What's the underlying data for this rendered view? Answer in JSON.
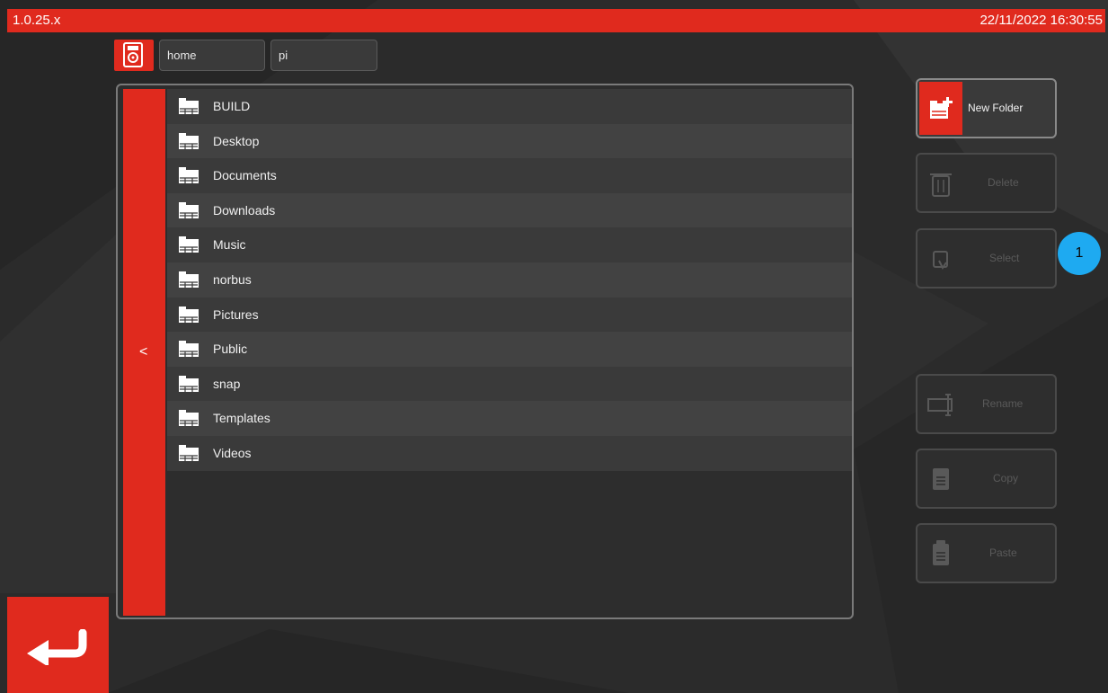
{
  "header": {
    "version": "1.0.25.x",
    "datetime": "22/11/2022 16:30:55"
  },
  "breadcrumb": {
    "root_icon": "drive-icon",
    "items": [
      "home",
      "pi"
    ]
  },
  "file_list": {
    "back_label": "<",
    "folders": [
      "BUILD",
      "Desktop",
      "Documents",
      "Downloads",
      "Music",
      "norbus",
      "Pictures",
      "Public",
      "snap",
      "Templates",
      "Videos"
    ]
  },
  "actions": {
    "new_folder": "New Folder",
    "delete": "Delete",
    "select": "Select",
    "rename": "Rename",
    "copy": "Copy",
    "paste": "Paste"
  },
  "callout": {
    "label": "1"
  },
  "colors": {
    "accent": "#e02a1e",
    "callout": "#1eaaf1"
  }
}
